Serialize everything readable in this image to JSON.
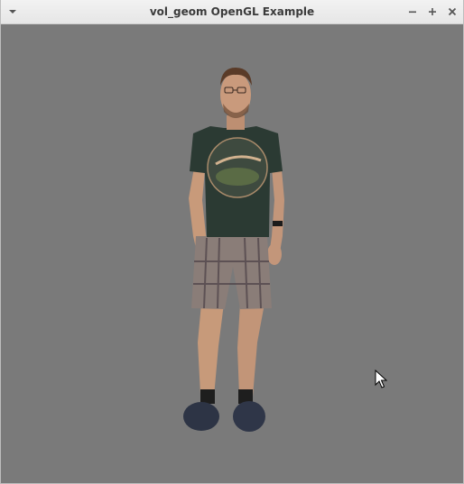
{
  "window": {
    "title": "vol_geom OpenGL Example",
    "background_color": "#7a7a7a"
  },
  "titlebar": {
    "icons": [
      "menu-arrow-icon",
      "minimize-icon",
      "maximize-icon",
      "close-icon"
    ]
  },
  "viewport": {
    "content": "rendered-person-model",
    "tshirt_color": "#2b3a33",
    "shorts_color": "#8a7d78"
  }
}
